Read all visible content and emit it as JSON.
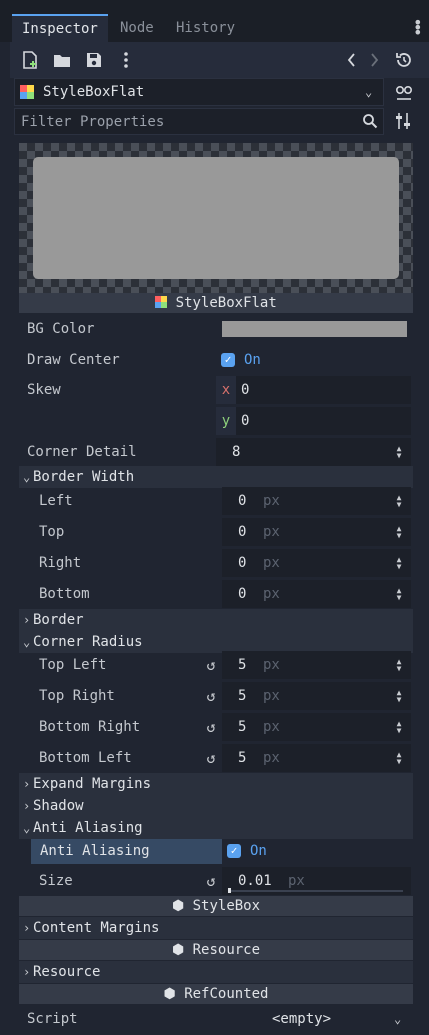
{
  "tabs": [
    {
      "label": "Inspector",
      "active": true
    },
    {
      "label": "Node",
      "active": false
    },
    {
      "label": "History",
      "active": false
    }
  ],
  "picker": {
    "value": "StyleBoxFlat"
  },
  "filter": {
    "placeholder": "Filter Properties"
  },
  "preview": {
    "title": "StyleBoxFlat"
  },
  "props": {
    "bg_color": {
      "label": "BG Color",
      "color": "#999999"
    },
    "draw_center": {
      "label": "Draw Center",
      "value": "On"
    },
    "skew": {
      "label": "Skew",
      "x_label": "x",
      "x": "0",
      "y_label": "y",
      "y": "0"
    },
    "corner_detail": {
      "label": "Corner Detail",
      "value": "8"
    }
  },
  "border_width": {
    "title": "Border Width",
    "items": [
      {
        "label": "Left",
        "value": "0",
        "unit": "px"
      },
      {
        "label": "Top",
        "value": "0",
        "unit": "px"
      },
      {
        "label": "Right",
        "value": "0",
        "unit": "px"
      },
      {
        "label": "Bottom",
        "value": "0",
        "unit": "px"
      }
    ]
  },
  "border": {
    "title": "Border"
  },
  "corner_radius": {
    "title": "Corner Radius",
    "items": [
      {
        "label": "Top Left",
        "value": "5",
        "unit": "px"
      },
      {
        "label": "Top Right",
        "value": "5",
        "unit": "px"
      },
      {
        "label": "Bottom Right",
        "value": "5",
        "unit": "px"
      },
      {
        "label": "Bottom Left",
        "value": "5",
        "unit": "px"
      }
    ]
  },
  "expand_margins": {
    "title": "Expand Margins"
  },
  "shadow": {
    "title": "Shadow"
  },
  "anti_aliasing": {
    "title": "Anti Aliasing",
    "aa_label": "Anti Aliasing",
    "aa_value": "On",
    "size_label": "Size",
    "size_value": "0.01",
    "size_unit": "px"
  },
  "stylebox": {
    "title": "StyleBox"
  },
  "content_margins": {
    "title": "Content Margins"
  },
  "resource_header": {
    "title": "Resource"
  },
  "resource_section": {
    "title": "Resource"
  },
  "refcounted": {
    "title": "RefCounted"
  },
  "script": {
    "label": "Script",
    "value": "<empty>"
  },
  "colors": {
    "accent": "#5aa2f0",
    "panel": "#202531",
    "field": "#1c2029",
    "section": "#2a303d",
    "header": "#353b48"
  }
}
